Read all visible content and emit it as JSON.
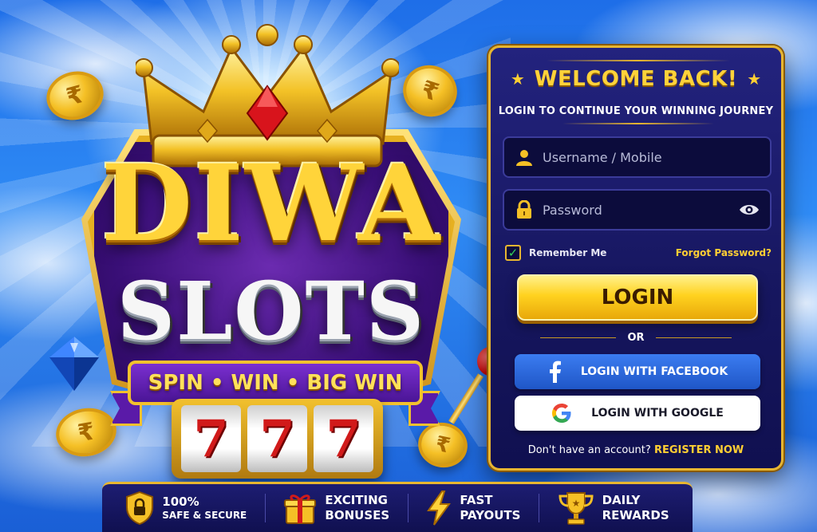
{
  "brand": {
    "name_top": "DIWA",
    "name_bottom": "SLOTS",
    "tagline": "SPIN • WIN • BIG WIN",
    "reels": [
      "7",
      "7",
      "7"
    ],
    "coin_symbol": "₹"
  },
  "login": {
    "title": "WELCOME BACK!",
    "subtitle": "LOGIN TO CONTINUE YOUR WINNING JOURNEY",
    "username_placeholder": "Username / Mobile",
    "password_placeholder": "Password",
    "remember_label": "Remember Me",
    "remember_checked": true,
    "forgot_label": "Forgot Password?",
    "login_button": "LOGIN",
    "or_text": "OR",
    "facebook_button": "LOGIN WITH FACEBOOK",
    "google_button": "LOGIN WITH GOOGLE",
    "register_prompt": "Don't have an account?",
    "register_link": "REGISTER NOW"
  },
  "features": [
    {
      "icon": "shield-lock-icon",
      "line1": "100%",
      "line2": "SAFE & SECURE"
    },
    {
      "icon": "gift-icon",
      "line1": "EXCITING",
      "line2": "BONUSES"
    },
    {
      "icon": "lightning-icon",
      "line1": "FAST",
      "line2": "PAYOUTS"
    },
    {
      "icon": "trophy-icon",
      "line1": "DAILY",
      "line2": "REWARDS"
    }
  ],
  "colors": {
    "gold": "#ffd23a",
    "panel": "#16165e",
    "facebook": "#1f56c7",
    "check": "#32d15a"
  }
}
